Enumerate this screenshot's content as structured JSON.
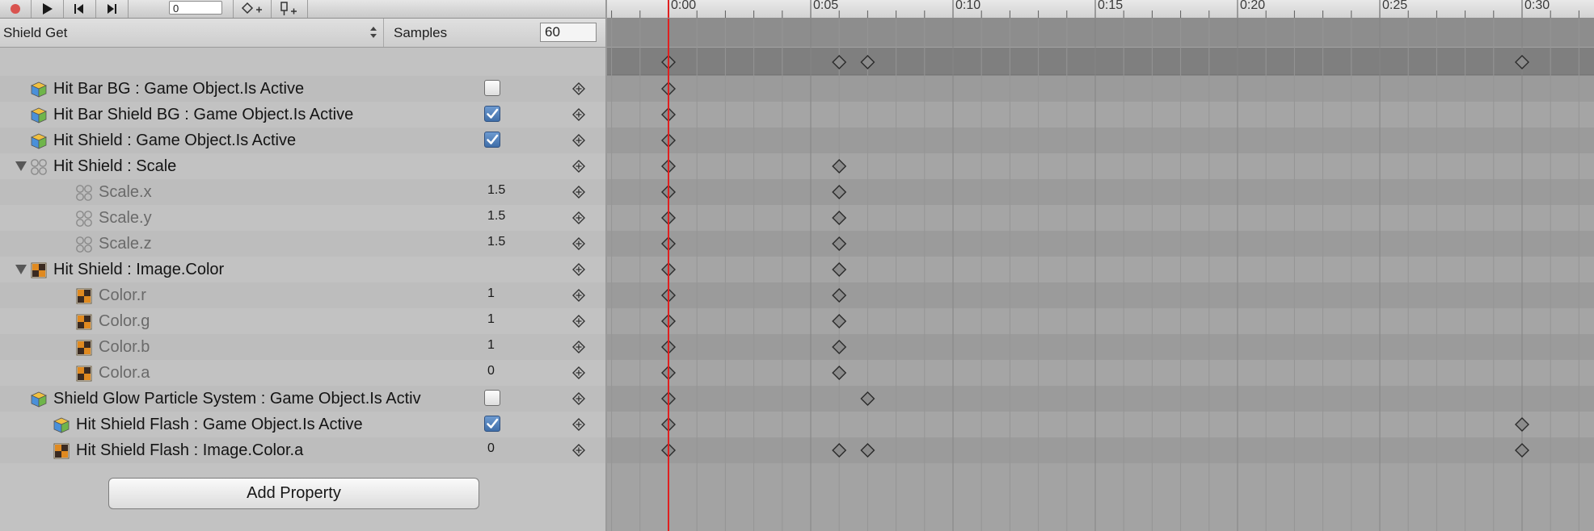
{
  "toolbar": {
    "buttons": [
      {
        "name": "record-button",
        "icon": "record-icon"
      },
      {
        "name": "play-button",
        "icon": "play-icon"
      },
      {
        "name": "prev-key-button",
        "icon": "prev-key-icon"
      },
      {
        "name": "next-key-button",
        "icon": "next-key-icon"
      }
    ],
    "frame_value": "0",
    "add_keyframe_icon": "add-keyframe-icon",
    "add_event_icon": "add-event-icon",
    "record_color": "#d9534f"
  },
  "clip": {
    "name": "Shield Get",
    "samples_label": "Samples",
    "samples_value": "60"
  },
  "properties": [
    {
      "label": "Hit Bar BG : Game Object.Is Active",
      "kind": "checkbox",
      "checked": false,
      "icon": "gameobject-icon",
      "indent": 1,
      "sub": false,
      "keys": [
        0
      ]
    },
    {
      "label": "Hit Bar Shield BG : Game Object.Is Active",
      "kind": "checkbox",
      "checked": true,
      "icon": "gameobject-icon",
      "indent": 1,
      "sub": false,
      "keys": [
        0
      ]
    },
    {
      "label": "Hit Shield : Game Object.Is Active",
      "kind": "checkbox",
      "checked": true,
      "icon": "gameobject-icon",
      "indent": 1,
      "sub": false,
      "keys": [
        0
      ]
    },
    {
      "label": "Hit Shield : Scale",
      "kind": "group",
      "icon": "transform-icon",
      "indent": 1,
      "sub": false,
      "foldout": true,
      "keys": [
        0,
        6
      ]
    },
    {
      "label": "Scale.x",
      "kind": "value",
      "value": "1.5",
      "icon": "transform-icon",
      "indent": 2,
      "sub": true,
      "keys": [
        0,
        6
      ]
    },
    {
      "label": "Scale.y",
      "kind": "value",
      "value": "1.5",
      "icon": "transform-icon",
      "indent": 2,
      "sub": true,
      "keys": [
        0,
        6
      ]
    },
    {
      "label": "Scale.z",
      "kind": "value",
      "value": "1.5",
      "icon": "transform-icon",
      "indent": 2,
      "sub": true,
      "keys": [
        0,
        6
      ]
    },
    {
      "label": "Hit Shield : Image.Color",
      "kind": "group",
      "icon": "image-icon",
      "indent": 1,
      "sub": false,
      "foldout": true,
      "keys": [
        0,
        6
      ]
    },
    {
      "label": "Color.r",
      "kind": "value",
      "value": "1",
      "icon": "image-icon",
      "indent": 2,
      "sub": true,
      "keys": [
        0,
        6
      ]
    },
    {
      "label": "Color.g",
      "kind": "value",
      "value": "1",
      "icon": "image-icon",
      "indent": 2,
      "sub": true,
      "keys": [
        0,
        6
      ]
    },
    {
      "label": "Color.b",
      "kind": "value",
      "value": "1",
      "icon": "image-icon",
      "indent": 2,
      "sub": true,
      "keys": [
        0,
        6
      ]
    },
    {
      "label": "Color.a",
      "kind": "value",
      "value": "0",
      "icon": "image-icon",
      "indent": 2,
      "sub": true,
      "keys": [
        0,
        6
      ]
    },
    {
      "label": "Shield Glow Particle System : Game Object.Is Activ",
      "kind": "checkbox",
      "checked": false,
      "icon": "gameobject-icon",
      "indent": 1,
      "sub": false,
      "keys": [
        0,
        7
      ]
    },
    {
      "label": "Hit Shield Flash : Game Object.Is Active",
      "kind": "checkbox",
      "checked": true,
      "icon": "gameobject-icon",
      "indent": 1.5,
      "sub": false,
      "keys": [
        0,
        30
      ]
    },
    {
      "label": "Hit Shield Flash : Image.Color.a",
      "kind": "value",
      "value": "0",
      "icon": "image-icon",
      "indent": 1.5,
      "sub": false,
      "keys": [
        0,
        6,
        7,
        30
      ]
    }
  ],
  "summary_keys": [
    0,
    6,
    7,
    30
  ],
  "add_property_label": "Add Property",
  "timeline": {
    "tick_labels": [
      "0:00",
      "0:05",
      "0:10",
      "0:15",
      "0:20",
      "0:25",
      "0:30"
    ],
    "playhead_frame": 0,
    "playhead_color": "#e02020"
  }
}
